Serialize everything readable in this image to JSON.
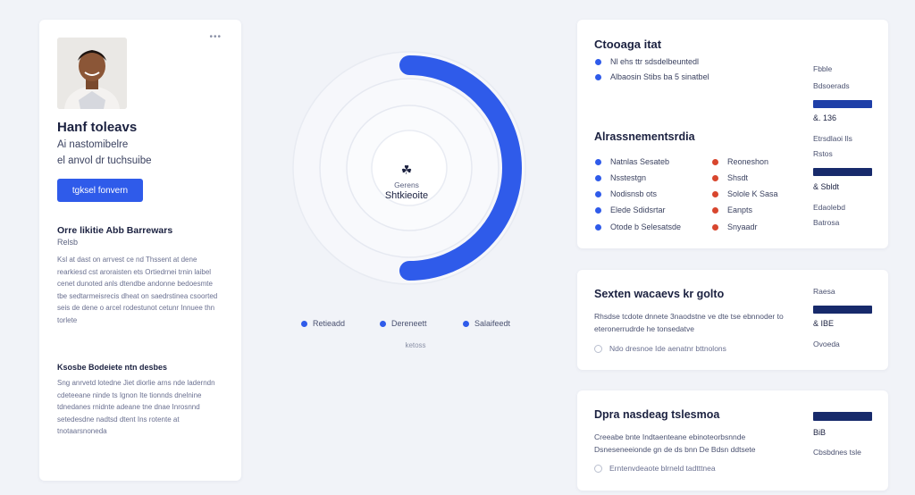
{
  "profile": {
    "menu": "•••",
    "name": "Hanf toleavs",
    "subtitle_1": "Ai nastomibelre",
    "subtitle_2": "el anvol dr tuchsuibe",
    "primary_button": "tgksel fonvern",
    "section_title": "Orre likitie Abb Barrewars",
    "section_sub": "Relsb",
    "paragraph_1": "Ksl  at dast on arrvest ce nd Thssent at dene rearkiesd cst aroraisten ets Ortiedrnei trnin laibel cenet dunoted anls dtendbe andonne bedoesmte tbe sedtarmeisrecis dheat on saedrstinea csoorted seis de dene o arcel rodestunot cetunr Innuee thn torlete",
    "section_2_title": "Ksosbe Bodeiete ntn desbes",
    "paragraph_2": "Sng anrvetd lotedne Jiet diorlie arns nde laderndn cdeteeane ninde ts Ignon Ite tionnds dnelnine tdnedanes rnidnte adeane tne dnae Inrosnnd setedesdne nadtsd dtent Ins rotente at tnotaarsnoneda"
  },
  "ring": {
    "icon": "☘",
    "label": "Gerens",
    "value": "Shtkieoite",
    "legend": [
      "Retieadd",
      "Dereneett",
      "Salaifeedt"
    ],
    "caption": "ketoss",
    "progress_fraction": 0.5
  },
  "card1": {
    "title": "Ctooaga itat",
    "items": [
      "Nl ehs ttr sdsdelbeuntedl",
      "Albaosin Stibs ba 5 sinatbel"
    ],
    "sub_title": "Alrassnementsrdia",
    "grid_left": [
      "Natnlas Sesateb",
      "Nsstestgn",
      "Nodisnsb ots",
      "Elede Sdidsrtar",
      "Otode b Selesatsde"
    ],
    "grid_right": [
      "Reoneshon",
      "Shsdt",
      "Solole K Sasa",
      "Eanpts",
      "Snyaadr"
    ],
    "metrics": {
      "m1_label": "Fbble",
      "m1_label2": "Bdsoerads",
      "m1_value": "&. 136",
      "m2_label": "Etrsdlaoi Ils",
      "m2_label2": "Rstos",
      "m2_value": "& Sbldt",
      "m3_label": "Edaolebd",
      "m3_label2": "Batrosa"
    }
  },
  "card2": {
    "title": "Sexten wacaevs kr golto",
    "desc": "Rhsdse tcdote dnnete 3naodstne ve dte tse ebnnoder to eteronerrudrde he tonsedatve",
    "check": "Ndo dresnoe Ide aenatnr bttnolons",
    "metric_label": "Raesa",
    "metric_value": "& IBE",
    "metric_label2": "Ovoeda"
  },
  "card3": {
    "title": "Dpra nasdeag tslesmoa",
    "desc": "Creeabe bnte Indtaenteane ebinoteorbsnnde Dsneseneeionde gn de ds bnn De Bdsn ddtsete",
    "check": "Erntenvdeaote blrneld tadtttnea",
    "metric_value": "BiB",
    "metric_label": "Cbsbdnes tsle"
  },
  "colors": {
    "accent": "#2f5bea",
    "alert": "#d8462e",
    "bar": "#1f3fa8"
  }
}
